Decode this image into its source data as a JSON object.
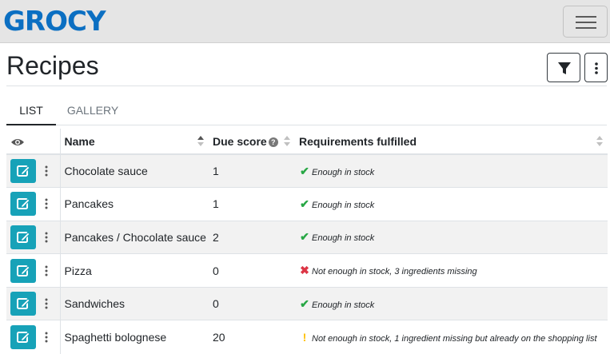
{
  "app": {
    "logo_text": "GROCY"
  },
  "page": {
    "title": "Recipes"
  },
  "tabs": [
    {
      "label": "LIST",
      "active": true
    },
    {
      "label": "GALLERY",
      "active": false
    }
  ],
  "table": {
    "headers": {
      "visibility_icon": "eye-icon",
      "name": "Name",
      "due_score": "Due score",
      "requirements": "Requirements fulfilled"
    },
    "rows": [
      {
        "name": "Chocolate sauce",
        "due_score": "1",
        "status": "ok",
        "status_icon": "✔",
        "requirements": "Enough in stock"
      },
      {
        "name": "Pancakes",
        "due_score": "1",
        "status": "ok",
        "status_icon": "✔",
        "requirements": "Enough in stock"
      },
      {
        "name": "Pancakes / Chocolate sauce",
        "due_score": "2",
        "status": "ok",
        "status_icon": "✔",
        "requirements": "Enough in stock"
      },
      {
        "name": "Pizza",
        "due_score": "0",
        "status": "bad",
        "status_icon": "✖",
        "requirements": "Not enough in stock, 3 ingredients missing"
      },
      {
        "name": "Sandwiches",
        "due_score": "0",
        "status": "ok",
        "status_icon": "✔",
        "requirements": "Enough in stock"
      },
      {
        "name": "Spaghetti bolognese",
        "due_score": "20",
        "status": "warn",
        "status_icon": "!",
        "requirements": "Not enough in stock, 1 ingredient missing but already on the shopping list"
      }
    ]
  },
  "colors": {
    "accent": "#17a2b8",
    "logo": "#0b6fc2",
    "ok": "#28a745",
    "bad": "#dc3545",
    "warn": "#ffc107"
  }
}
